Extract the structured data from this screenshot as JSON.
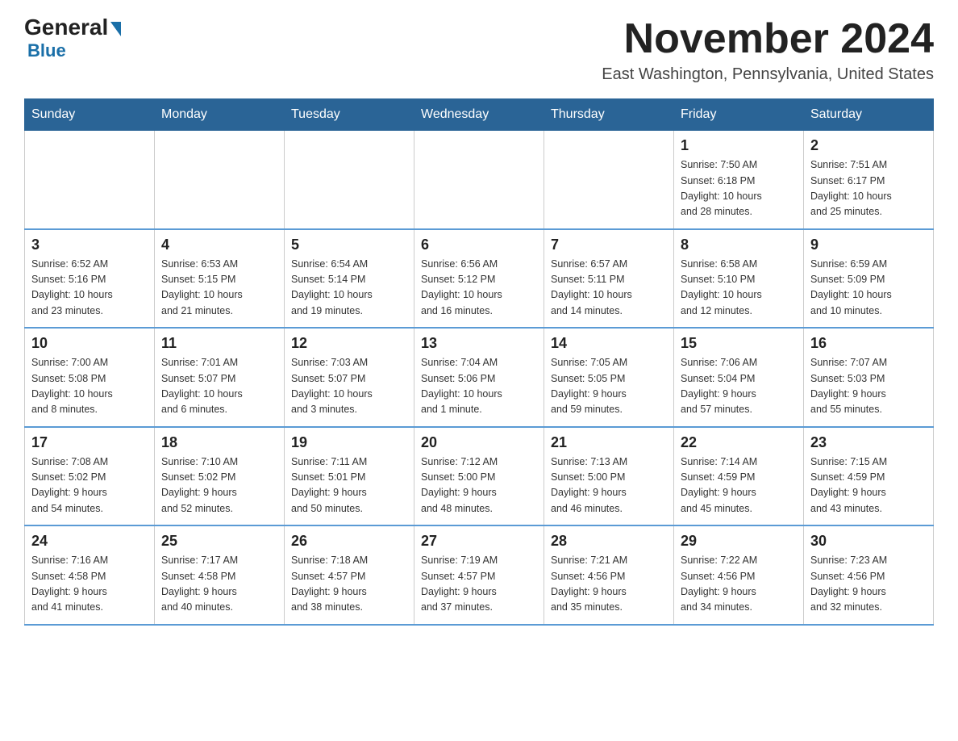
{
  "logo": {
    "general": "General",
    "blue": "Blue"
  },
  "title": {
    "month_year": "November 2024",
    "location": "East Washington, Pennsylvania, United States"
  },
  "headers": [
    "Sunday",
    "Monday",
    "Tuesday",
    "Wednesday",
    "Thursday",
    "Friday",
    "Saturday"
  ],
  "weeks": [
    [
      {
        "day": "",
        "info": ""
      },
      {
        "day": "",
        "info": ""
      },
      {
        "day": "",
        "info": ""
      },
      {
        "day": "",
        "info": ""
      },
      {
        "day": "",
        "info": ""
      },
      {
        "day": "1",
        "info": "Sunrise: 7:50 AM\nSunset: 6:18 PM\nDaylight: 10 hours\nand 28 minutes."
      },
      {
        "day": "2",
        "info": "Sunrise: 7:51 AM\nSunset: 6:17 PM\nDaylight: 10 hours\nand 25 minutes."
      }
    ],
    [
      {
        "day": "3",
        "info": "Sunrise: 6:52 AM\nSunset: 5:16 PM\nDaylight: 10 hours\nand 23 minutes."
      },
      {
        "day": "4",
        "info": "Sunrise: 6:53 AM\nSunset: 5:15 PM\nDaylight: 10 hours\nand 21 minutes."
      },
      {
        "day": "5",
        "info": "Sunrise: 6:54 AM\nSunset: 5:14 PM\nDaylight: 10 hours\nand 19 minutes."
      },
      {
        "day": "6",
        "info": "Sunrise: 6:56 AM\nSunset: 5:12 PM\nDaylight: 10 hours\nand 16 minutes."
      },
      {
        "day": "7",
        "info": "Sunrise: 6:57 AM\nSunset: 5:11 PM\nDaylight: 10 hours\nand 14 minutes."
      },
      {
        "day": "8",
        "info": "Sunrise: 6:58 AM\nSunset: 5:10 PM\nDaylight: 10 hours\nand 12 minutes."
      },
      {
        "day": "9",
        "info": "Sunrise: 6:59 AM\nSunset: 5:09 PM\nDaylight: 10 hours\nand 10 minutes."
      }
    ],
    [
      {
        "day": "10",
        "info": "Sunrise: 7:00 AM\nSunset: 5:08 PM\nDaylight: 10 hours\nand 8 minutes."
      },
      {
        "day": "11",
        "info": "Sunrise: 7:01 AM\nSunset: 5:07 PM\nDaylight: 10 hours\nand 6 minutes."
      },
      {
        "day": "12",
        "info": "Sunrise: 7:03 AM\nSunset: 5:07 PM\nDaylight: 10 hours\nand 3 minutes."
      },
      {
        "day": "13",
        "info": "Sunrise: 7:04 AM\nSunset: 5:06 PM\nDaylight: 10 hours\nand 1 minute."
      },
      {
        "day": "14",
        "info": "Sunrise: 7:05 AM\nSunset: 5:05 PM\nDaylight: 9 hours\nand 59 minutes."
      },
      {
        "day": "15",
        "info": "Sunrise: 7:06 AM\nSunset: 5:04 PM\nDaylight: 9 hours\nand 57 minutes."
      },
      {
        "day": "16",
        "info": "Sunrise: 7:07 AM\nSunset: 5:03 PM\nDaylight: 9 hours\nand 55 minutes."
      }
    ],
    [
      {
        "day": "17",
        "info": "Sunrise: 7:08 AM\nSunset: 5:02 PM\nDaylight: 9 hours\nand 54 minutes."
      },
      {
        "day": "18",
        "info": "Sunrise: 7:10 AM\nSunset: 5:02 PM\nDaylight: 9 hours\nand 52 minutes."
      },
      {
        "day": "19",
        "info": "Sunrise: 7:11 AM\nSunset: 5:01 PM\nDaylight: 9 hours\nand 50 minutes."
      },
      {
        "day": "20",
        "info": "Sunrise: 7:12 AM\nSunset: 5:00 PM\nDaylight: 9 hours\nand 48 minutes."
      },
      {
        "day": "21",
        "info": "Sunrise: 7:13 AM\nSunset: 5:00 PM\nDaylight: 9 hours\nand 46 minutes."
      },
      {
        "day": "22",
        "info": "Sunrise: 7:14 AM\nSunset: 4:59 PM\nDaylight: 9 hours\nand 45 minutes."
      },
      {
        "day": "23",
        "info": "Sunrise: 7:15 AM\nSunset: 4:59 PM\nDaylight: 9 hours\nand 43 minutes."
      }
    ],
    [
      {
        "day": "24",
        "info": "Sunrise: 7:16 AM\nSunset: 4:58 PM\nDaylight: 9 hours\nand 41 minutes."
      },
      {
        "day": "25",
        "info": "Sunrise: 7:17 AM\nSunset: 4:58 PM\nDaylight: 9 hours\nand 40 minutes."
      },
      {
        "day": "26",
        "info": "Sunrise: 7:18 AM\nSunset: 4:57 PM\nDaylight: 9 hours\nand 38 minutes."
      },
      {
        "day": "27",
        "info": "Sunrise: 7:19 AM\nSunset: 4:57 PM\nDaylight: 9 hours\nand 37 minutes."
      },
      {
        "day": "28",
        "info": "Sunrise: 7:21 AM\nSunset: 4:56 PM\nDaylight: 9 hours\nand 35 minutes."
      },
      {
        "day": "29",
        "info": "Sunrise: 7:22 AM\nSunset: 4:56 PM\nDaylight: 9 hours\nand 34 minutes."
      },
      {
        "day": "30",
        "info": "Sunrise: 7:23 AM\nSunset: 4:56 PM\nDaylight: 9 hours\nand 32 minutes."
      }
    ]
  ]
}
